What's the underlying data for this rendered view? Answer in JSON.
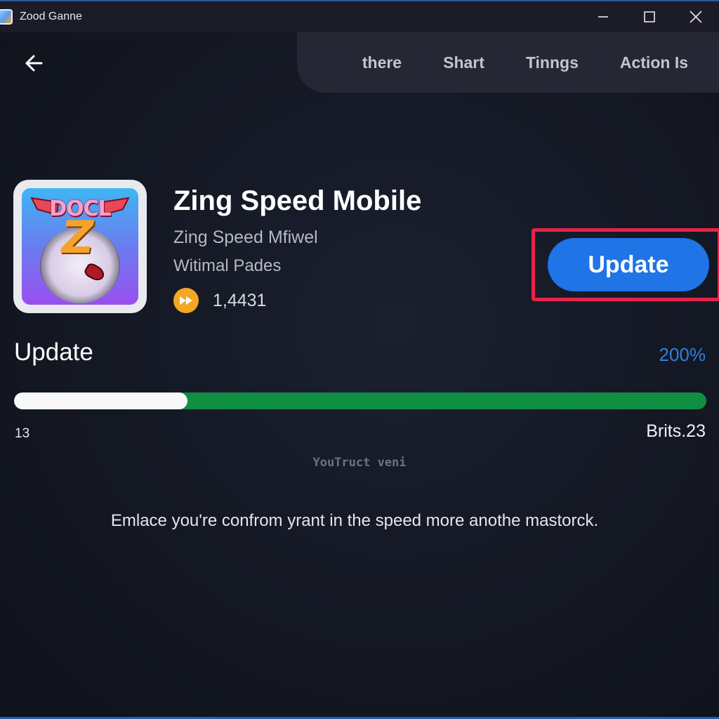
{
  "window": {
    "title": "Zood Ganne",
    "controls": {
      "minimize": "minimize-icon",
      "maximize": "maximize-icon",
      "close": "close-icon"
    }
  },
  "nav": {
    "back_icon": "arrow-left-icon",
    "tabs": [
      {
        "label": "there"
      },
      {
        "label": "Shart"
      },
      {
        "label": "Tinngs"
      },
      {
        "label": "Action Is"
      }
    ]
  },
  "app": {
    "icon_logo_text": "DOCL",
    "icon_logo_letter": "Z",
    "title": "Zing Speed Mobile",
    "subtitle": "Zing Speed Mfiwel",
    "developer": "Witimal Pades",
    "rating_icon": "fast-forward-icon",
    "rating_value": "1,4431",
    "update_button": "Update"
  },
  "progress": {
    "label": "Update",
    "percent_text": "200%",
    "fill_fraction": 0.25,
    "left_value": "13",
    "right_value": "Brits.23",
    "status_note": "YouTruct  veni"
  },
  "message": "Emlace you're confrom yrant in the speed more anothe mastorck.",
  "colors": {
    "accent_blue": "#1f74e6",
    "highlight_red": "#e8234a",
    "progress_green": "#0f8e44",
    "rating_orange": "#f5a623"
  }
}
